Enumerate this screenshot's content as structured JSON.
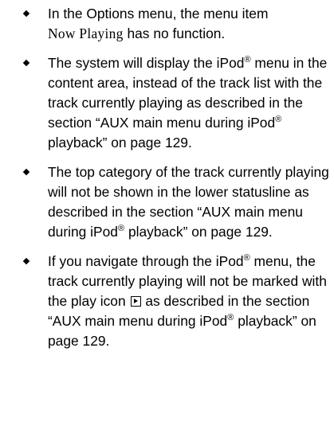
{
  "bullets": [
    {
      "text_before": "In the Options menu, the menu item",
      "menu_item": "Now Playing",
      "text_after": "has no function."
    },
    {
      "text_1": "The system will display the iPod",
      "reg_1": "®",
      "text_2": "menu in the content area, instead of the track list with the track currently playing as described in the section “AUX main menu during iPod",
      "reg_2": "®",
      "text_3": "playback” on page 129."
    },
    {
      "text_1": "The top category of the track currently playing will not be shown in the lower statusline as described in the section “AUX main menu during iPod",
      "reg_1": "®",
      "text_2": "playback” on page 129."
    },
    {
      "text_1": "If you navigate through the iPod",
      "reg_1": "®",
      "text_2": "menu, the track currently playing will not be marked with the play icon",
      "icon": "play-icon",
      "text_3": "as described in the section “AUX main menu during iPod",
      "reg_2": "®",
      "text_4": "playback” on page 129."
    }
  ]
}
